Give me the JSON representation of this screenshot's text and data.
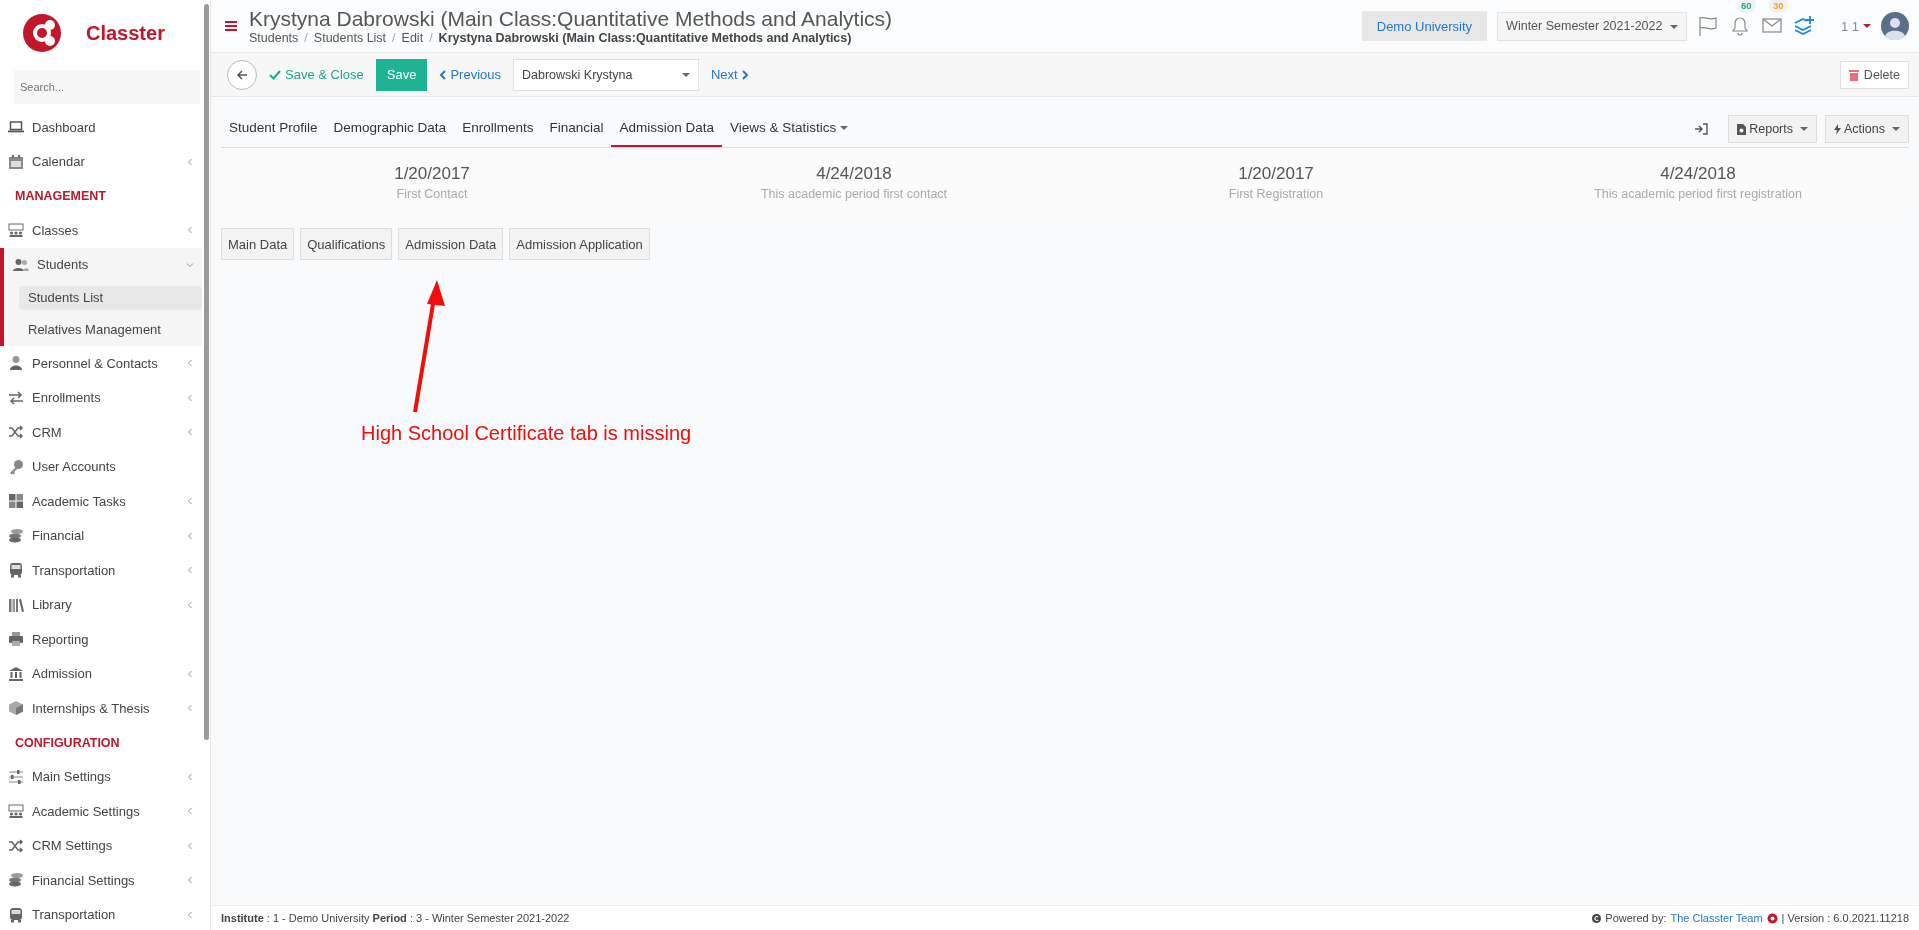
{
  "brand": {
    "name": "Classter"
  },
  "sidebar": {
    "search": {
      "placeholder": "Search..."
    },
    "items": [
      {
        "kind": "item",
        "label": "Dashboard",
        "expandable": false,
        "expanded": false
      },
      {
        "kind": "item",
        "label": "Calendar",
        "expandable": true,
        "expanded": false
      },
      {
        "kind": "section",
        "label": "MANAGEMENT"
      },
      {
        "kind": "item",
        "label": "Classes",
        "expandable": true,
        "expanded": false
      },
      {
        "kind": "item",
        "label": "Students",
        "expandable": true,
        "expanded": true,
        "children": [
          {
            "label": "Students List",
            "selected": true
          },
          {
            "label": "Relatives Management",
            "selected": false
          }
        ]
      },
      {
        "kind": "item",
        "label": "Personnel & Contacts",
        "expandable": true,
        "expanded": false
      },
      {
        "kind": "item",
        "label": "Enrollments",
        "expandable": true,
        "expanded": false
      },
      {
        "kind": "item",
        "label": "CRM",
        "expandable": true,
        "expanded": false
      },
      {
        "kind": "item",
        "label": "User Accounts",
        "expandable": false,
        "expanded": false
      },
      {
        "kind": "item",
        "label": "Academic Tasks",
        "expandable": true,
        "expanded": false
      },
      {
        "kind": "item",
        "label": "Financial",
        "expandable": true,
        "expanded": false
      },
      {
        "kind": "item",
        "label": "Transportation",
        "expandable": true,
        "expanded": false
      },
      {
        "kind": "item",
        "label": "Library",
        "expandable": true,
        "expanded": false
      },
      {
        "kind": "item",
        "label": "Reporting",
        "expandable": false,
        "expanded": false
      },
      {
        "kind": "item",
        "label": "Admission",
        "expandable": true,
        "expanded": false
      },
      {
        "kind": "item",
        "label": "Internships & Thesis",
        "expandable": true,
        "expanded": false
      },
      {
        "kind": "section",
        "label": "CONFIGURATION"
      },
      {
        "kind": "item",
        "label": "Main Settings",
        "expandable": true,
        "expanded": false
      },
      {
        "kind": "item",
        "label": "Academic Settings",
        "expandable": true,
        "expanded": false
      },
      {
        "kind": "item",
        "label": "CRM Settings",
        "expandable": true,
        "expanded": false
      },
      {
        "kind": "item",
        "label": "Financial Settings",
        "expandable": true,
        "expanded": false
      },
      {
        "kind": "item",
        "label": "Transportation",
        "expandable": true,
        "expanded": false
      }
    ]
  },
  "header": {
    "title": "Krystyna Dabrowski (Main Class:Quantitative Methods and Analytics)",
    "breadcrumb": [
      {
        "label": "Students",
        "current": false
      },
      {
        "label": "Students List",
        "current": false
      },
      {
        "label": "Edit",
        "current": false
      },
      {
        "label": "Krystyna Dabrowski (Main Class:Quantitative Methods and Analytics)",
        "current": true
      }
    ],
    "separator": "/",
    "institution": "Demo University",
    "period": "Winter Semester 2021-2022",
    "notifications": "60",
    "messages": "30",
    "user": "1 1"
  },
  "toolbar": {
    "save_close": "Save & Close",
    "save": "Save",
    "previous": "Previous",
    "record": "Dabrowski Krystyna",
    "next": "Next",
    "delete": "Delete"
  },
  "tabs": [
    {
      "label": "Student Profile",
      "selected": false,
      "kind": "tab"
    },
    {
      "label": "Demographic Data",
      "selected": false,
      "kind": "tab"
    },
    {
      "label": "Enrollments",
      "selected": false,
      "kind": "tab"
    },
    {
      "label": "Financial",
      "selected": false,
      "kind": "tab"
    },
    {
      "label": "Admission Data",
      "selected": true,
      "kind": "tab"
    },
    {
      "label": "Views & Statistics",
      "selected": false,
      "kind": "menu"
    }
  ],
  "tab_actions": {
    "reports": "Reports",
    "actions": "Actions"
  },
  "stats": [
    {
      "value": "1/20/2017",
      "label": "First Contact"
    },
    {
      "value": "4/24/2018",
      "label": "This academic period first contact"
    },
    {
      "value": "1/20/2017",
      "label": "First Registration"
    },
    {
      "value": "4/24/2018",
      "label": "This academic period first registration"
    }
  ],
  "subtabs": [
    "Main Data",
    "Qualifications",
    "Admission Data",
    "Admission Application"
  ],
  "annotation": {
    "text": "High School Certificate tab is missing"
  },
  "footer": {
    "context": "**Institute** : 1 - Demo University **Period** : 3 - Winter Semester 2021-2022",
    "powered": "Powered by:",
    "team": "The Classter Team",
    "version": "| Version : 6.0.2021.11218"
  }
}
